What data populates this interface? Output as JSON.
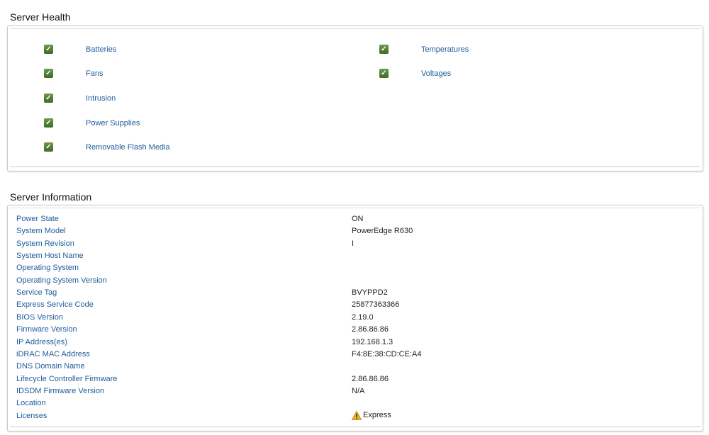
{
  "health": {
    "title": "Server Health",
    "items": [
      {
        "label": "Batteries",
        "status": "ok"
      },
      {
        "label": "Fans",
        "status": "ok"
      },
      {
        "label": "Intrusion",
        "status": "ok"
      },
      {
        "label": "Power Supplies",
        "status": "ok"
      },
      {
        "label": "Removable Flash Media",
        "status": "ok"
      },
      {
        "label": "Temperatures",
        "status": "ok"
      },
      {
        "label": "Voltages",
        "status": "ok"
      }
    ]
  },
  "info": {
    "title": "Server Information",
    "rows": [
      {
        "label": "Power State",
        "value": "ON"
      },
      {
        "label": "System Model",
        "value": "PowerEdge R630"
      },
      {
        "label": "System Revision",
        "value": "I"
      },
      {
        "label": "System Host Name",
        "value": ""
      },
      {
        "label": "Operating System",
        "value": ""
      },
      {
        "label": "Operating System Version",
        "value": ""
      },
      {
        "label": "Service Tag",
        "value": "BVYPPD2"
      },
      {
        "label": "Express Service Code",
        "value": "25877363366"
      },
      {
        "label": "BIOS Version",
        "value": "2.19.0"
      },
      {
        "label": "Firmware Version",
        "value": "2.86.86.86"
      },
      {
        "label": "IP Address(es)",
        "value": "192.168.1.3"
      },
      {
        "label": "iDRAC MAC Address",
        "value": "F4:8E:38:CD:CE:A4"
      },
      {
        "label": "DNS Domain Name",
        "value": ""
      },
      {
        "label": "Lifecycle Controller Firmware",
        "value": "2.86.86.86"
      },
      {
        "label": "IDSDM Firmware Version",
        "value": "N/A"
      },
      {
        "label": "Location",
        "value": ""
      },
      {
        "label": "Licenses",
        "value": "Express",
        "icon": "warning-icon"
      }
    ]
  }
}
